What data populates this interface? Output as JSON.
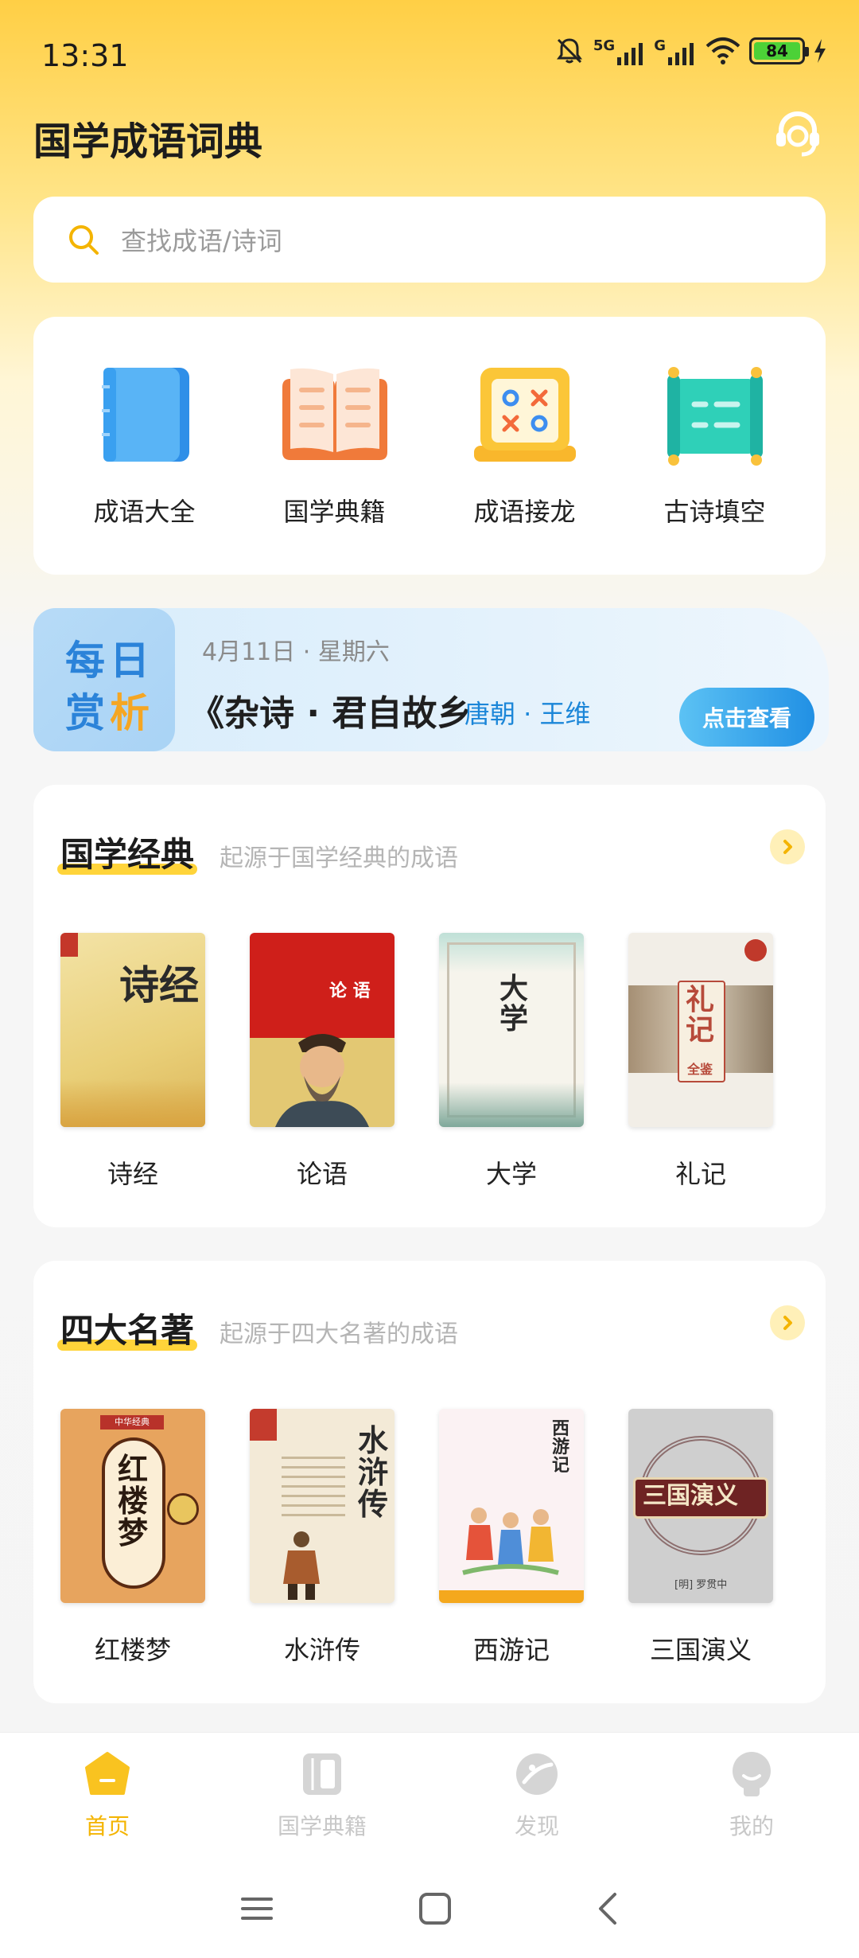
{
  "status_bar": {
    "time": "13:31",
    "network_1": "5G",
    "network_2": "G",
    "battery": "84"
  },
  "header": {
    "title": "国学成语词典"
  },
  "search": {
    "placeholder": "查找成语/诗词"
  },
  "quick_menu": [
    {
      "label": "成语大全",
      "icon": "book-blue-icon"
    },
    {
      "label": "国学典籍",
      "icon": "open-book-icon"
    },
    {
      "label": "成语接龙",
      "icon": "tic-tac-toe-icon"
    },
    {
      "label": "古诗填空",
      "icon": "scroll-icon"
    }
  ],
  "daily": {
    "badge": [
      "每",
      "日",
      "赏",
      "析"
    ],
    "date": "4月11日 · 星期六",
    "poem": "《杂诗 · 君自故乡",
    "author": "唐朝 · 王维",
    "button": "点击查看"
  },
  "sections": [
    {
      "title": "国学经典",
      "subtitle": "起源于国学经典的成语",
      "books": [
        {
          "label": "诗经",
          "cover_text": "诗经"
        },
        {
          "label": "论语",
          "cover_text": "论 语"
        },
        {
          "label": "大学",
          "cover_text": "大学"
        },
        {
          "label": "礼记",
          "cover_text": "礼记",
          "cover_sub": "全鉴"
        }
      ]
    },
    {
      "title": "四大名著",
      "subtitle": "起源于四大名著的成语",
      "books": [
        {
          "label": "红楼梦",
          "cover_text": "红楼梦",
          "cover_tag": "中华经典"
        },
        {
          "label": "水浒传",
          "cover_text": "水浒传"
        },
        {
          "label": "西游记",
          "cover_text": "西游记"
        },
        {
          "label": "三国演义",
          "cover_text": "三国演义",
          "cover_sub": "[明] 罗贯中"
        }
      ]
    }
  ],
  "bottom_nav": [
    {
      "label": "首页",
      "active": true
    },
    {
      "label": "国学典籍",
      "active": false
    },
    {
      "label": "发现",
      "active": false
    },
    {
      "label": "我的",
      "active": false
    }
  ],
  "colors": {
    "accent": "#f4b400",
    "blue": "#1b86d8"
  }
}
